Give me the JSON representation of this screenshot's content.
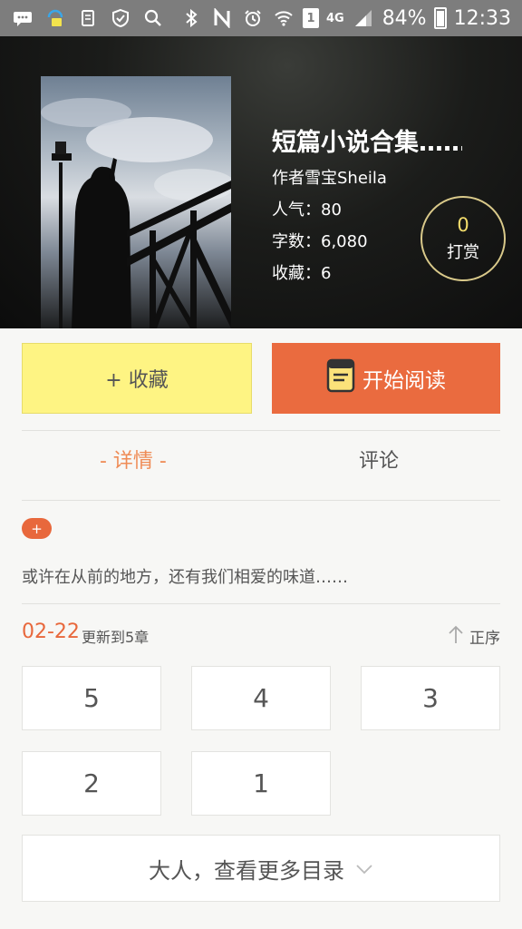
{
  "status_bar": {
    "battery": "84%",
    "time": "12:33",
    "sim_slot": "1",
    "network": "4G",
    "battery_level": 0.84,
    "icons": [
      "message-icon",
      "app-icon",
      "clipboard-icon",
      "shield-icon",
      "search-icon",
      "bluetooth-icon",
      "nfc-icon",
      "alarm-icon",
      "wifi-icon",
      "signal-icon",
      "battery-icon"
    ]
  },
  "book": {
    "title": "短篇小说合集……",
    "author": "作者雪宝Sheila",
    "popularity": "人气：80",
    "word_count": "字数：6,080",
    "favorites": "收藏：6"
  },
  "reward": {
    "count": "0",
    "label": "打赏"
  },
  "actions": {
    "collect_label": "+ 收藏",
    "read_label": "开始阅读"
  },
  "tabs": {
    "detail": "- 详情 -",
    "comments": "评论"
  },
  "tag": "+",
  "description": "或许在从前的地方，还有我们相爱的味道……",
  "update": {
    "date": "02-22",
    "text": "更新到5章",
    "order_label": "正序"
  },
  "chapters": [
    "5",
    "4",
    "3",
    "2",
    "1"
  ],
  "more_label": "大人，查看更多目录",
  "colors": {
    "accent_orange": "#ea6b3f",
    "collect_yellow": "#fef483",
    "reward_gold": "#f3dd6c",
    "status_bar": "#7d7d7d"
  }
}
